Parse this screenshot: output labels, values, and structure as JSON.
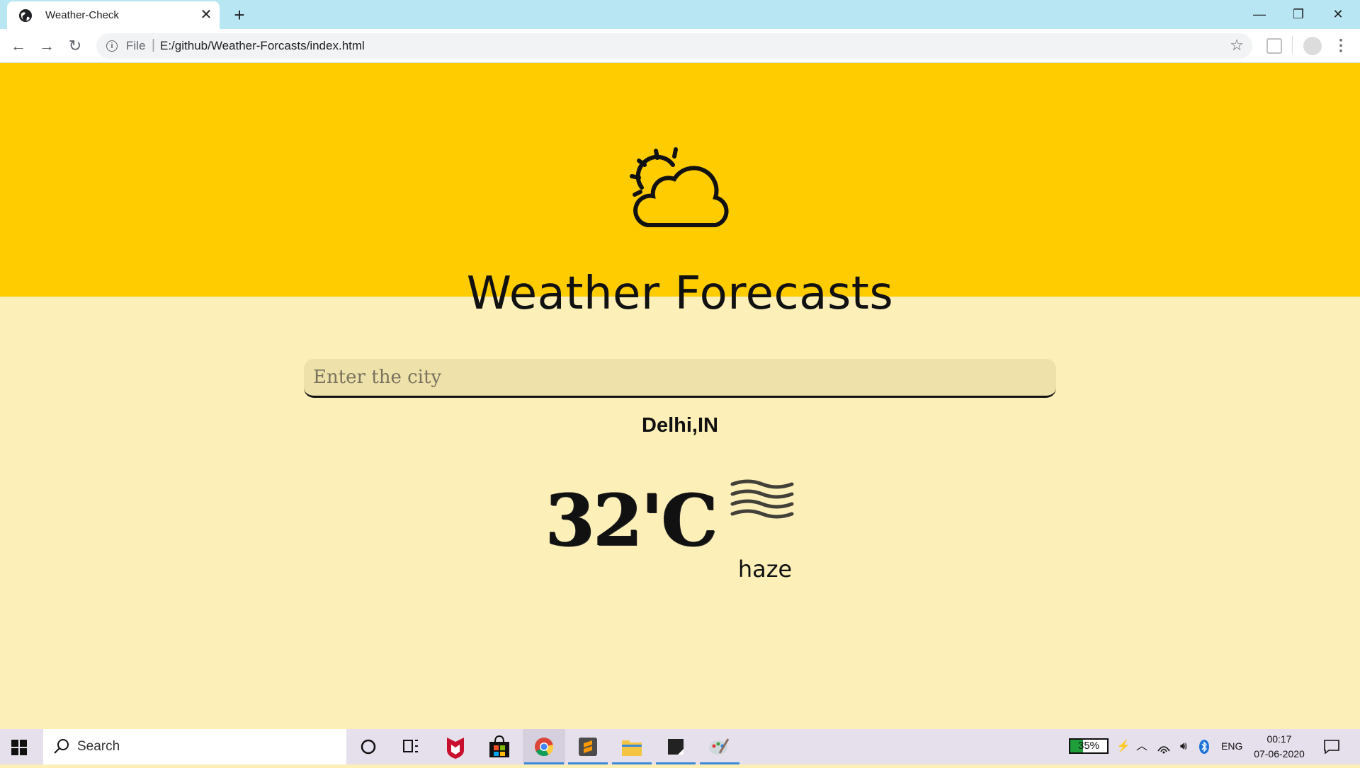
{
  "browser": {
    "tab_title": "Weather-Check",
    "tab_close": "✕",
    "new_tab": "+",
    "window": {
      "minimize": "—",
      "restore": "❐",
      "close": "✕"
    },
    "nav": {
      "back": "←",
      "forward": "→",
      "reload": "↻"
    },
    "address": {
      "scheme_label": "File",
      "separator": "|",
      "url": "E:/github/Weather-Forcasts/index.html"
    },
    "bookmark_star": "☆",
    "menu": "⋮"
  },
  "page": {
    "title": "Weather Forecasts",
    "search": {
      "placeholder": "Enter the city",
      "value": ""
    },
    "city": "Delhi,IN",
    "temperature": "32'C",
    "description": "haze",
    "colors": {
      "hero": "#ffcc00",
      "background": "#fdefb8",
      "input": "#efe1aa"
    },
    "icons": {
      "logo": "sun-behind-cloud-icon",
      "condition": "haze-icon"
    }
  },
  "taskbar": {
    "search_text": "Search",
    "apps": [
      "cortana-icon",
      "task-view-icon",
      "mcafee-icon",
      "microsoft-store-icon",
      "chrome-icon",
      "sublime-text-icon",
      "file-explorer-icon",
      "sticky-notes-icon",
      "paint-icon"
    ],
    "battery_percent": 35,
    "battery_label": "35%",
    "language": "ENG",
    "time": "00:17",
    "date": "07-06-2020"
  }
}
